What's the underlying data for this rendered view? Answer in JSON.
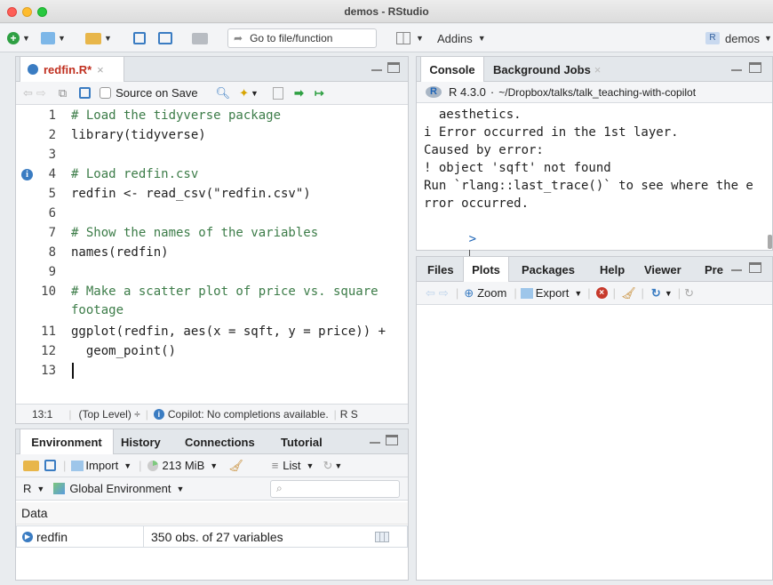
{
  "window": {
    "title": "demos - RStudio"
  },
  "toolbar": {
    "goto_label": "Go to file/function",
    "addins_label": "Addins",
    "project_label": "demos"
  },
  "editor": {
    "tab_label": "redfin.R*",
    "source_on_save_label": "Source on Save",
    "lines": [
      {
        "n": "1",
        "text": "# Load the tidyverse package",
        "kind": "comment"
      },
      {
        "n": "2",
        "text": "library(tidyverse)",
        "kind": "code"
      },
      {
        "n": "3",
        "text": "",
        "kind": "code"
      },
      {
        "n": "4",
        "text": "# Load redfin.csv",
        "kind": "comment"
      },
      {
        "n": "5",
        "text": "redfin <- read_csv(\"redfin.csv\")",
        "kind": "code"
      },
      {
        "n": "6",
        "text": "",
        "kind": "code"
      },
      {
        "n": "7",
        "text": "# Show the names of the variables",
        "kind": "comment"
      },
      {
        "n": "8",
        "text": "names(redfin)",
        "kind": "code"
      },
      {
        "n": "9",
        "text": "",
        "kind": "code"
      },
      {
        "n": "10",
        "text": "# Make a scatter plot of price vs. square",
        "kind": "comment"
      },
      {
        "n": "",
        "text": "footage",
        "kind": "comment"
      },
      {
        "n": "11",
        "text": "ggplot(redfin, aes(x = sqft, y = price)) +",
        "kind": "code"
      },
      {
        "n": "12",
        "text": "  geom_point()",
        "kind": "code"
      },
      {
        "n": "13",
        "text": "",
        "kind": "code"
      }
    ],
    "status_position": "13:1",
    "status_scope": "(Top Level) ÷",
    "status_copilot": "Copilot: No completions available.",
    "status_lang": "R S"
  },
  "console": {
    "tabs": [
      "Console",
      "Background Jobs"
    ],
    "r_version": "R 4.3.0",
    "path": "~/Dropbox/talks/talk_teaching-with-copilot",
    "lines": [
      "  aesthetics.",
      "i Error occurred in the 1st layer.",
      "Caused by error:",
      "! object 'sqft' not found",
      "Run `rlang::last_trace()` to see where the e",
      "rror occurred.",
      ">"
    ]
  },
  "files_pane": {
    "tabs": [
      "Files",
      "Plots",
      "Packages",
      "Help",
      "Viewer",
      "Pre"
    ],
    "zoom_label": "Zoom",
    "export_label": "Export"
  },
  "env_pane": {
    "tabs": [
      "Environment",
      "History",
      "Connections",
      "Tutorial"
    ],
    "import_label": "Import",
    "memory_label": "213 MiB",
    "list_label": "List",
    "lang_label": "R",
    "scope_label": "Global Environment",
    "section_label": "Data",
    "rows": [
      {
        "name": "redfin",
        "value": "350 obs. of 27 variables"
      }
    ]
  },
  "colors": {
    "accent": "#2f78c4",
    "error_red": "#d03030"
  }
}
